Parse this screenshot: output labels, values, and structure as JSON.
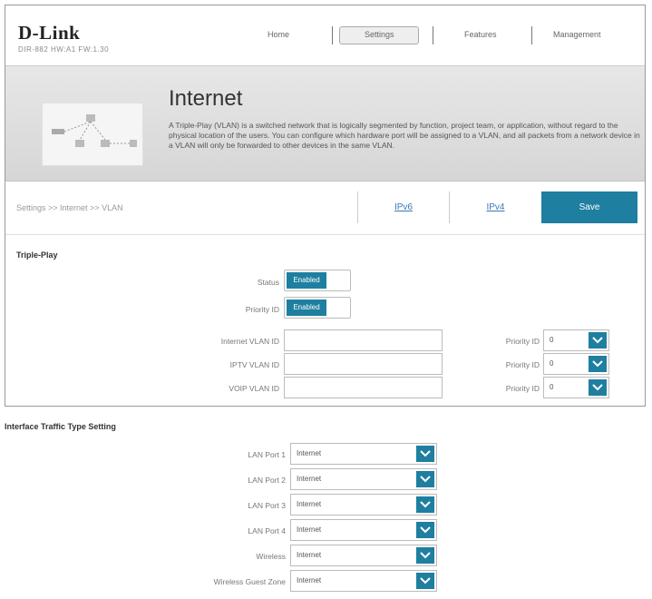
{
  "header": {
    "brand": "D-Link",
    "model": "DIR-882 HW:A1 FW:1.30",
    "nav": [
      {
        "label": "Home"
      },
      {
        "label": "Settings",
        "active": true
      },
      {
        "label": "Features"
      },
      {
        "label": "Management"
      }
    ]
  },
  "hero": {
    "title": "Internet",
    "description": "A Triple-Play (VLAN) is a switched network that is logically segmented by function, project team, or application, without regard to the physical location of the users. You can configure which hardware port will be assigned to a VLAN, and all packets from a network device in a VLAN will only be forwarded to other devices in the same VLAN."
  },
  "breadcrumb": "Settings >> Internet >> VLAN",
  "tabs": [
    {
      "label": "IPv6"
    },
    {
      "label": "IPv4"
    }
  ],
  "save_label": "Save",
  "triple_play": {
    "title": "Triple-Play",
    "status_label": "Status",
    "status_value": "Enabled",
    "priority_label": "Priority ID",
    "priority_value": "Enabled",
    "vlans": [
      {
        "label": "Internet VLAN ID",
        "value": "",
        "priority_label": "Priority ID",
        "priority": "0"
      },
      {
        "label": "IPTV VLAN ID",
        "value": "",
        "priority_label": "Priority ID",
        "priority": "0"
      },
      {
        "label": "VOIP VLAN ID",
        "value": "",
        "priority_label": "Priority ID",
        "priority": "0"
      }
    ]
  },
  "interface": {
    "title": "Interface Traffic Type Setting",
    "ports": [
      {
        "label": "LAN Port 1",
        "value": "Internet"
      },
      {
        "label": "LAN Port 2",
        "value": "Internet"
      },
      {
        "label": "LAN Port 3",
        "value": "Internet"
      },
      {
        "label": "LAN Port 4",
        "value": "Internet"
      },
      {
        "label": "Wireless",
        "value": "Internet"
      },
      {
        "label": "Wireless Guest Zone",
        "value": "Internet"
      }
    ]
  },
  "colors": {
    "accent": "#1f7fa0",
    "link": "#3b77b5"
  }
}
